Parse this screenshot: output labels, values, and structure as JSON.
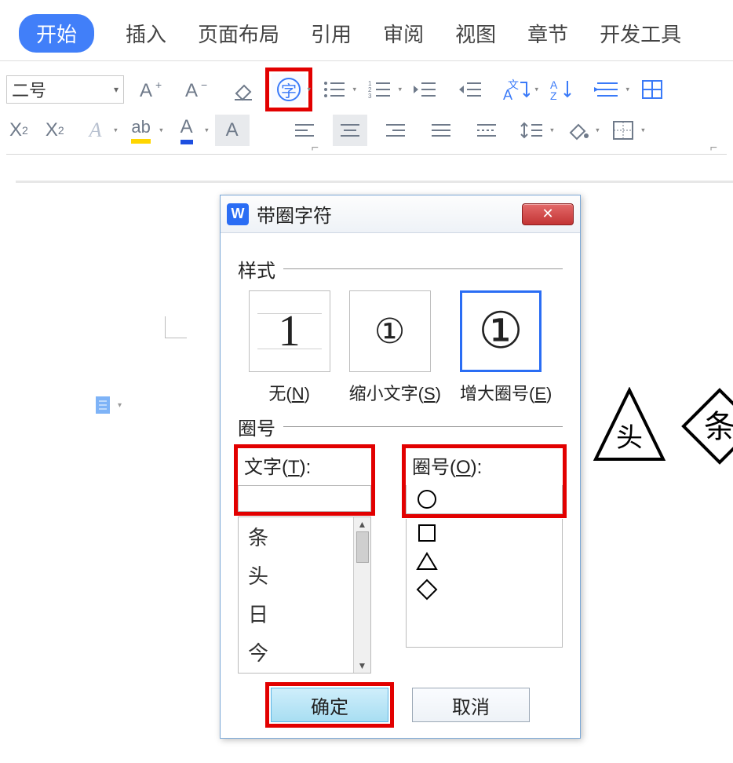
{
  "tabs": [
    "开始",
    "插入",
    "页面布局",
    "引用",
    "审阅",
    "视图",
    "章节",
    "开发工具"
  ],
  "active_tab_index": 0,
  "font_size_value": "二号",
  "dialog": {
    "title": "带圈字符",
    "section_style": "样式",
    "section_enclose": "圈号",
    "style_options": [
      {
        "glyph": "1",
        "caption": "无(N)",
        "underline_char": "N"
      },
      {
        "glyph": "①",
        "caption": "缩小文字(S)",
        "underline_char": "S"
      },
      {
        "glyph": "①",
        "caption": "增大圈号(E)",
        "underline_char": "E",
        "selected": true
      }
    ],
    "text_label": "文字(T):",
    "enclose_label": "圈号(O):",
    "text_list": [
      "条",
      "头",
      "日",
      "今"
    ],
    "shape_list": [
      "circle",
      "square",
      "triangle",
      "diamond"
    ],
    "selected_shape_index": 0,
    "ok": "确定",
    "cancel": "取消"
  },
  "bg_chars": {
    "triangle_char": "头",
    "diamond_char": "条"
  },
  "icons": {
    "grow_font": "A+",
    "shrink_font": "A-",
    "eraser": "eraser",
    "enclosed": "字",
    "superscript": "X²",
    "subscript": "X₂",
    "font_effects": "A",
    "strike": "ab",
    "font_color": "A",
    "highlight": "A"
  }
}
